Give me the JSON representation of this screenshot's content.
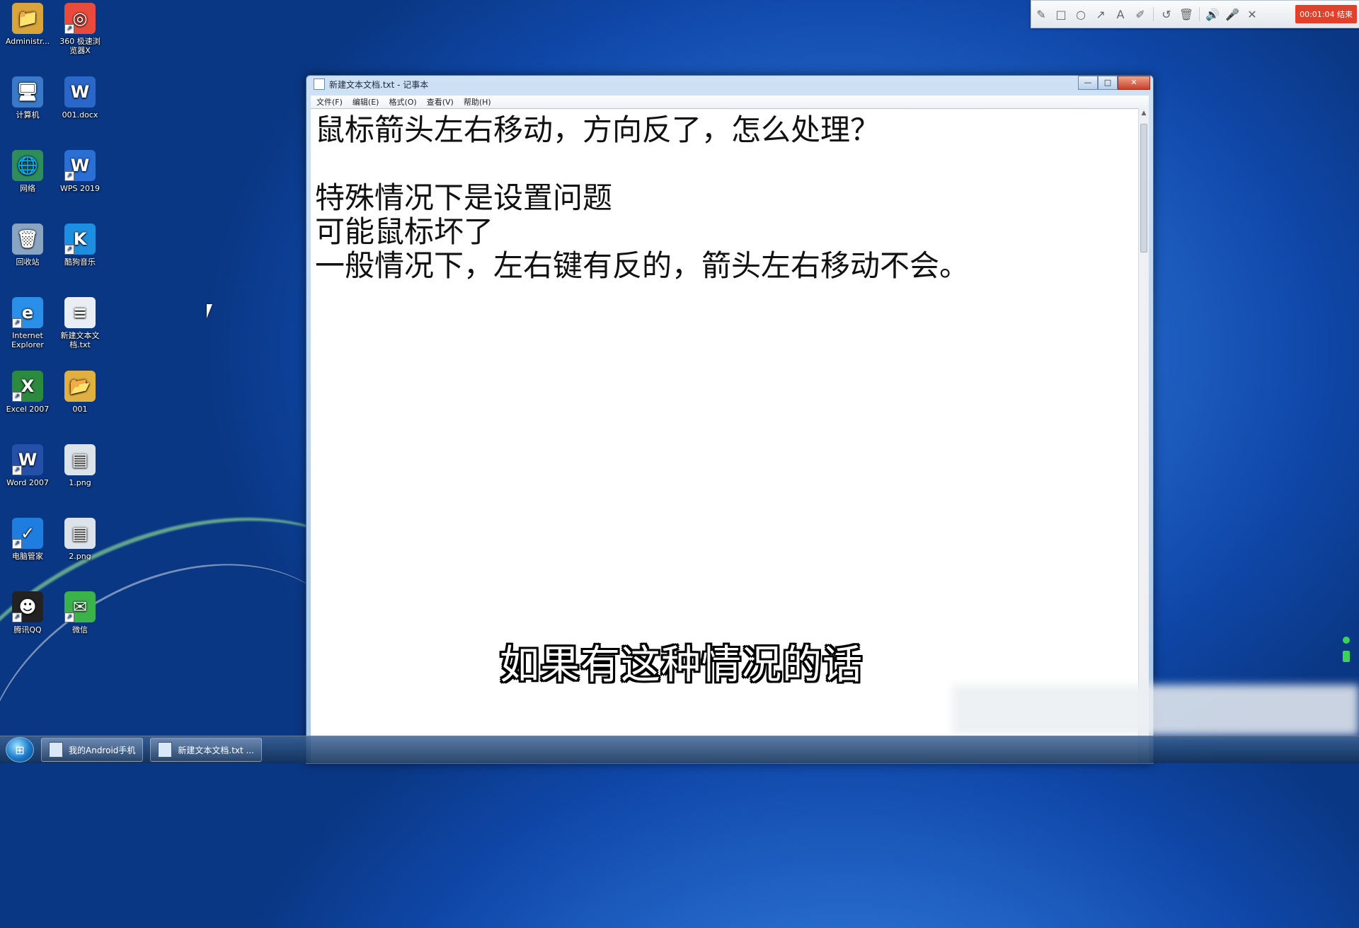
{
  "desktop_icons": [
    {
      "label": "Administr...",
      "glyph": "📁",
      "color": "#d9a53a"
    },
    {
      "label": "360 极速浏\n览器X",
      "glyph": "◎",
      "color": "#e84a3c"
    },
    {
      "label": "计算机",
      "glyph": "🖥",
      "color": "#3a79c7"
    },
    {
      "label": "001.docx",
      "glyph": "W",
      "color": "#2b66c9"
    },
    {
      "label": "网络",
      "glyph": "🌐",
      "color": "#2f8d5c"
    },
    {
      "label": "WPS 2019",
      "glyph": "W",
      "color": "#2a6fd6"
    },
    {
      "label": "回收站",
      "glyph": "🗑",
      "color": "#8aa5c2"
    },
    {
      "label": "酷狗音乐",
      "glyph": "K",
      "color": "#1e8fe0"
    },
    {
      "label": "Internet\nExplorer",
      "glyph": "e",
      "color": "#2a8fe8"
    },
    {
      "label": "新建文本文\n档.txt",
      "glyph": "≡",
      "color": "#e9eef4"
    },
    {
      "label": "Excel 2007",
      "glyph": "X",
      "color": "#2b8a3e"
    },
    {
      "label": "001",
      "glyph": "📂",
      "color": "#e0b040"
    },
    {
      "label": "Word 2007",
      "glyph": "W",
      "color": "#2450a8"
    },
    {
      "label": "1.png",
      "glyph": "▤",
      "color": "#dce3ea"
    },
    {
      "label": "电脑管家",
      "glyph": "✓",
      "color": "#1f7de0"
    },
    {
      "label": "2.png",
      "glyph": "▤",
      "color": "#dce3ea"
    },
    {
      "label": "腾讯QQ",
      "glyph": "☻",
      "color": "#222222"
    },
    {
      "label": "微信",
      "glyph": "✉",
      "color": "#3cb34a"
    }
  ],
  "toolbar": {
    "tools": [
      "✎",
      "□",
      "○",
      "↗",
      "A",
      "✐",
      "↺",
      "🗑"
    ],
    "dim_tools": [
      "🔊",
      "🎤"
    ],
    "close": "✕",
    "timer": "00:01:04 结束"
  },
  "notepad": {
    "title": "新建文本文档.txt - 记事本",
    "controls": {
      "minimize": "—",
      "maximize": "□",
      "close": "✕"
    },
    "menu": [
      "文件(F)",
      "编辑(E)",
      "格式(O)",
      "查看(V)",
      "帮助(H)"
    ],
    "lines": [
      "鼠标箭头左右移动，方向反了，怎么处理？",
      "",
      "特殊情况下是设置问题",
      "可能鼠标坏了",
      "一般情况下，左右键有反的，箭头左右移动不会。"
    ]
  },
  "subtitle": "如果有这种情况的话",
  "taskbar": {
    "start_glyph": "⊞",
    "items": [
      "我的Android手机",
      "新建文本文档.txt ..."
    ]
  }
}
